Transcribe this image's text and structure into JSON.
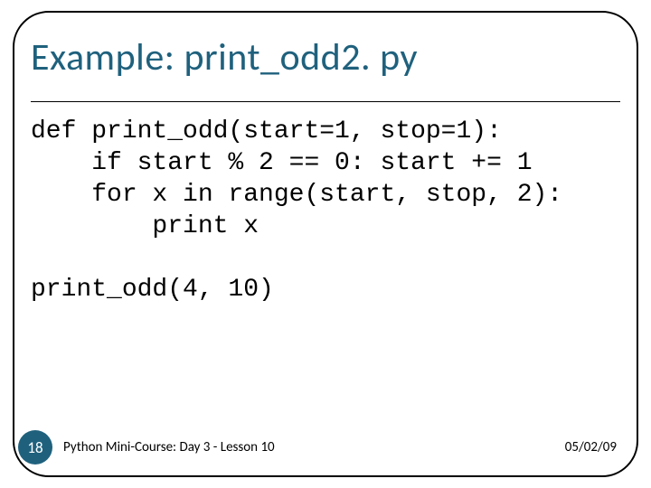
{
  "slide": {
    "title": "Example: print_odd2. py",
    "code": "def print_odd(start=1, stop=1):\n    if start % 2 == 0: start += 1\n    for x in range(start, stop, 2):\n        print x\n\nprint_odd(4, 10)",
    "number": "18",
    "footer_left": "Python Mini-Course: Day 3 - Lesson 10",
    "footer_right": "05/02/09"
  }
}
